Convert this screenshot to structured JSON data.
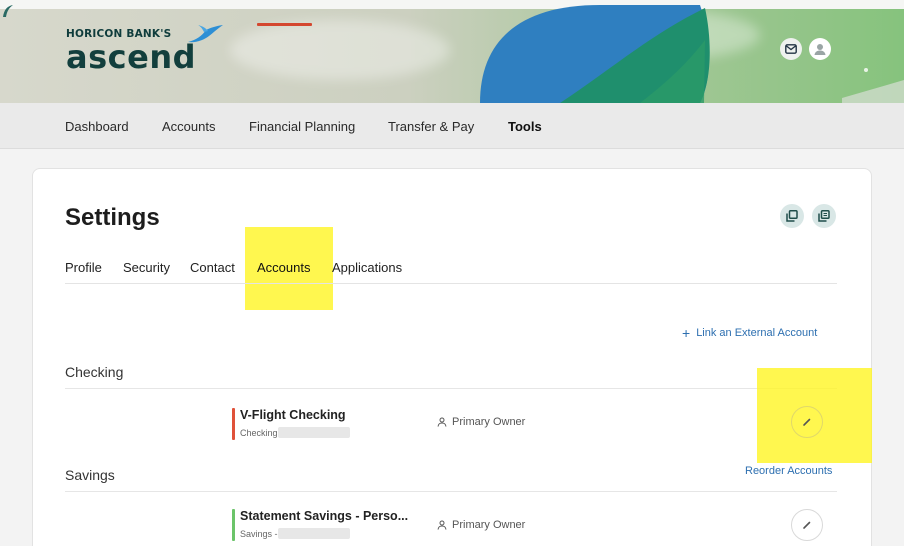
{
  "header": {
    "brand_small": "HORICON BANK'S",
    "brand_big": "ascend",
    "icons": [
      "mail-icon",
      "user-avatar-icon"
    ],
    "colors": {
      "brand_dark": "#123f3d",
      "accent_blue": "#2d8fd5",
      "hero_green": "#86c37d"
    }
  },
  "nav": {
    "items": [
      {
        "label": "Dashboard"
      },
      {
        "label": "Accounts"
      },
      {
        "label": "Financial Planning"
      },
      {
        "label": "Transfer & Pay"
      },
      {
        "label": "Tools"
      }
    ],
    "active": "Tools"
  },
  "settings": {
    "title": "Settings",
    "actions": [
      "export-icon",
      "print-icon"
    ],
    "tabs": [
      {
        "label": "Profile"
      },
      {
        "label": "Security"
      },
      {
        "label": "Contact"
      },
      {
        "label": "Accounts"
      },
      {
        "label": "Applications"
      }
    ],
    "active_tab": "Accounts",
    "link_external": "Link an External Account",
    "reorder": "Reorder Accounts",
    "sections": [
      {
        "label": "Checking",
        "accounts": [
          {
            "name": "V-Flight Checking",
            "type": "Checking",
            "owner": "Primary Owner",
            "color": "#e0523a"
          }
        ]
      },
      {
        "label": "Savings",
        "accounts": [
          {
            "name": "Statement Savings - Perso...",
            "type": "Savings - *",
            "owner": "Primary Owner",
            "color": "#6cc46a"
          }
        ]
      }
    ]
  },
  "colors": {
    "tab_underline": "#d4472f",
    "link": "#2d6fb0",
    "highlight": "#fff51e"
  }
}
